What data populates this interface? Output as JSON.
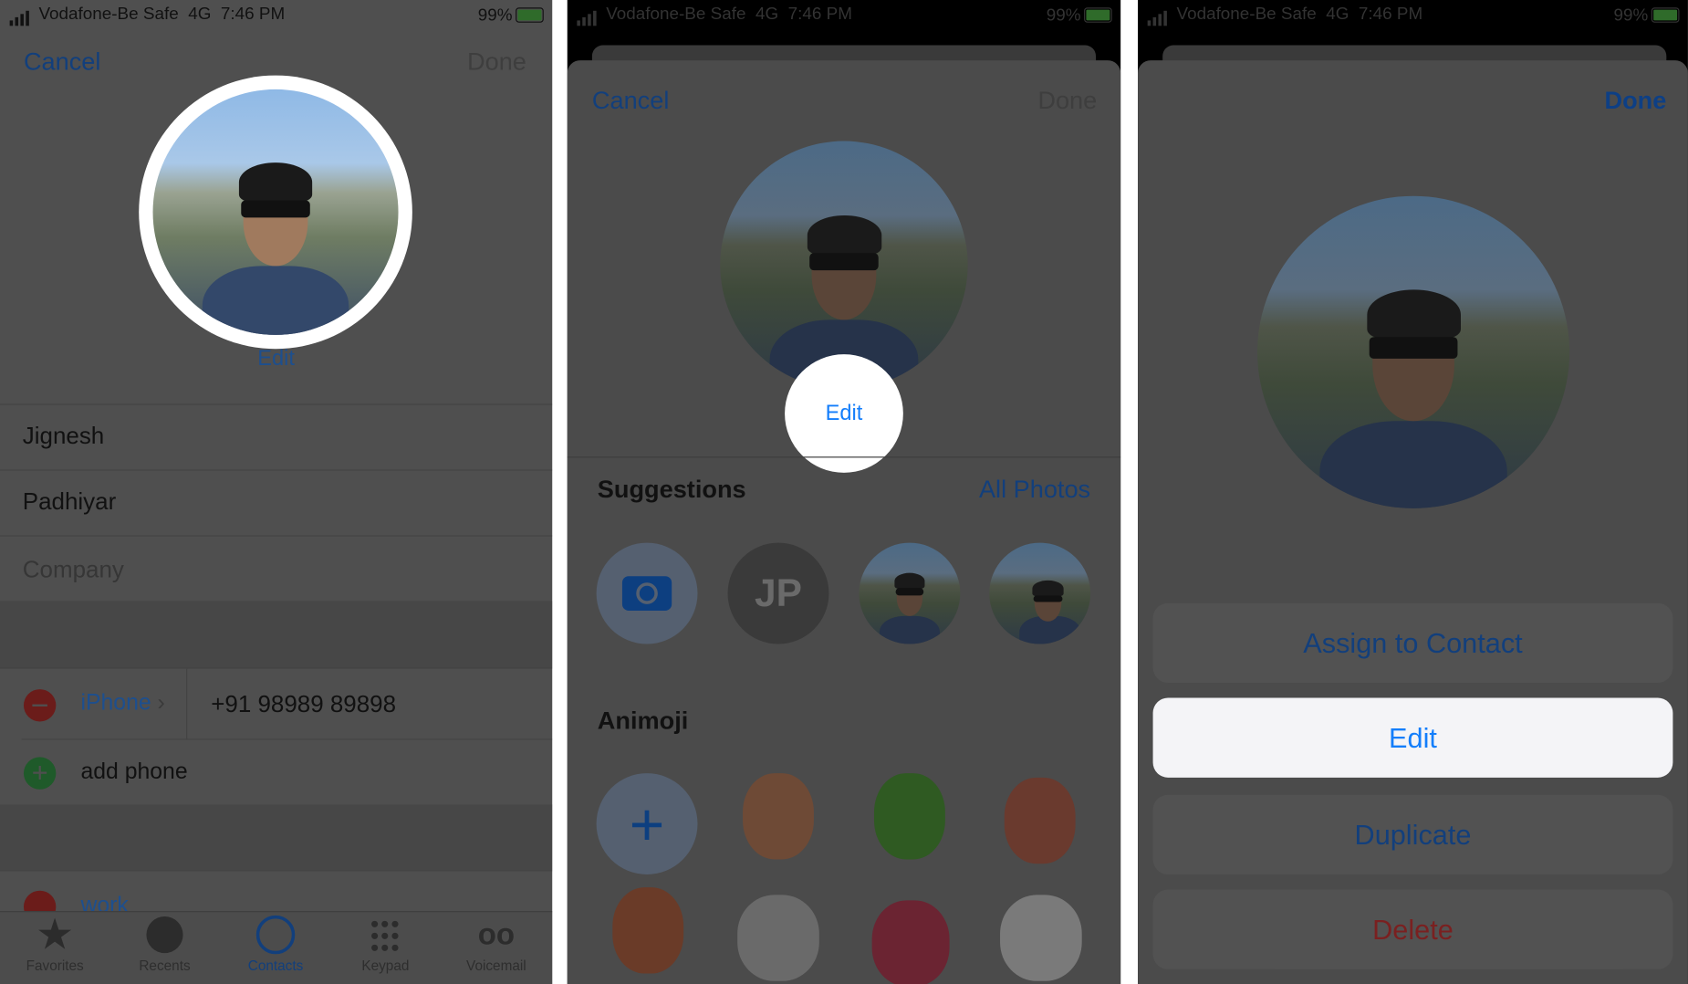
{
  "status_bar": {
    "carrier": "Vodafone-Be Safe",
    "network": "4G",
    "time": "7:46 PM",
    "battery": "99%"
  },
  "colors": {
    "ios_blue": "#147efb",
    "delete_red": "#e0332f",
    "add_green": "#2fb84b",
    "remove_red": "#d9302b"
  },
  "panel1": {
    "cancel": "Cancel",
    "done": "Done",
    "edit": "Edit",
    "first_name": "Jignesh",
    "last_name": "Padhiyar",
    "company_placeholder": "Company",
    "phone_label": "iPhone",
    "phone_number": "+91 98989 89898",
    "add_phone": "add phone",
    "email_label": "work",
    "tabs": [
      {
        "label": "Favorites",
        "icon": "star-icon"
      },
      {
        "label": "Recents",
        "icon": "clock-icon"
      },
      {
        "label": "Contacts",
        "icon": "person-circle-icon",
        "active": true
      },
      {
        "label": "Keypad",
        "icon": "keypad-icon"
      },
      {
        "label": "Voicemail",
        "icon": "voicemail-icon"
      }
    ]
  },
  "panel2": {
    "cancel": "Cancel",
    "done": "Done",
    "edit": "Edit",
    "suggestions_title": "Suggestions",
    "all_photos": "All Photos",
    "monogram": "JP",
    "animoji_title": "Animoji"
  },
  "panel3": {
    "done": "Done",
    "actions": [
      "Assign to Contact",
      "Edit",
      "Duplicate",
      "Delete"
    ]
  }
}
